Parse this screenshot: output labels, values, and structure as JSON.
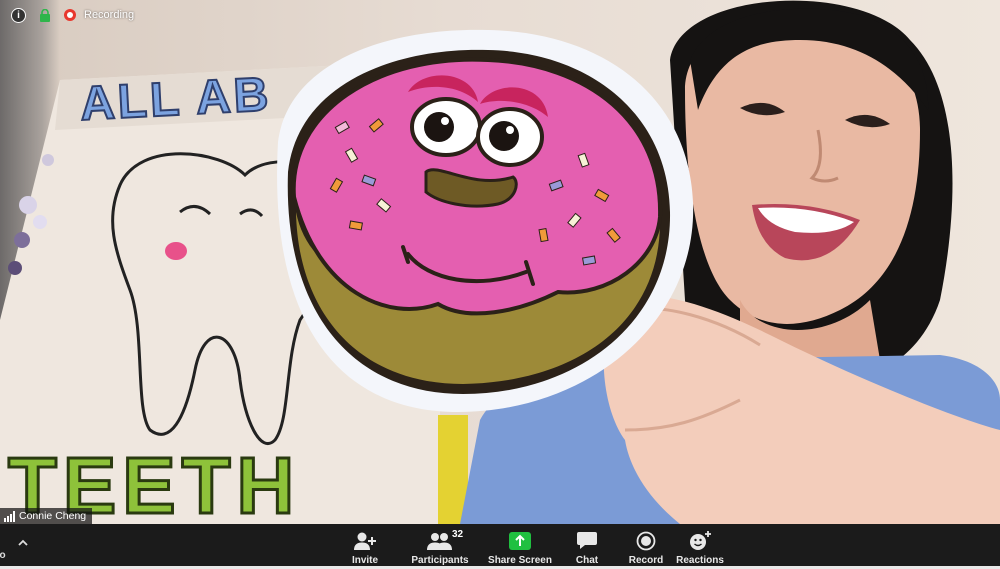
{
  "status": {
    "recording_label": "Recording"
  },
  "participant": {
    "name": "Connie Cheng"
  },
  "poster": {
    "line1": "ALL AB",
    "line2": "TEETH"
  },
  "toolbar": {
    "cut_label": "eo",
    "items": [
      {
        "label": "Invite",
        "icon": "add-user-icon"
      },
      {
        "label": "Participants",
        "icon": "participants-icon",
        "badge": "32"
      },
      {
        "label": "Share Screen",
        "icon": "share-screen-icon"
      },
      {
        "label": "Chat",
        "icon": "chat-icon"
      },
      {
        "label": "Record",
        "icon": "record-icon"
      },
      {
        "label": "Reactions",
        "icon": "reactions-icon"
      }
    ]
  },
  "colors": {
    "share_green": "#20c040",
    "record_red": "#e8382e",
    "donut_pink": "#e45fb0"
  }
}
